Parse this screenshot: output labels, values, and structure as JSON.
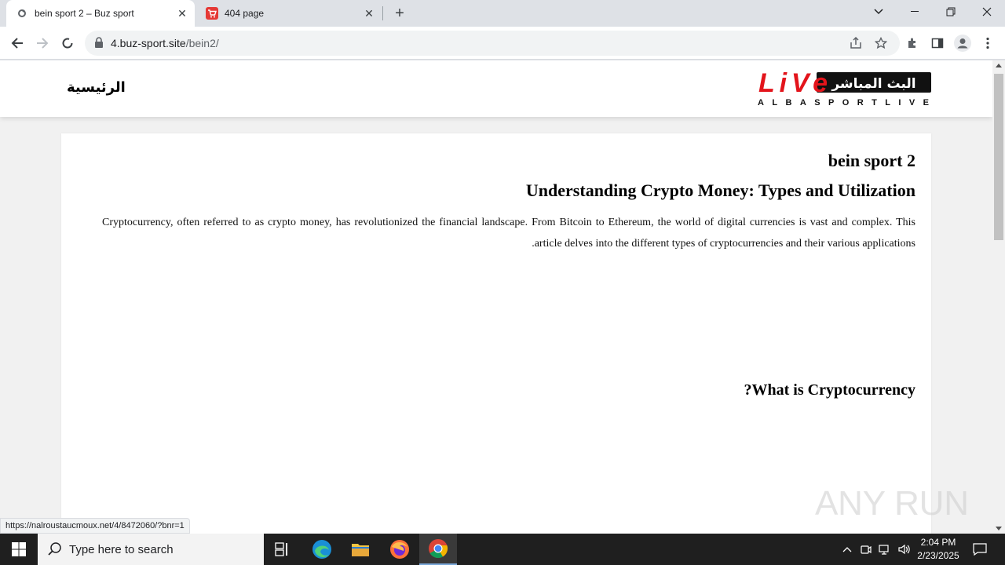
{
  "browser": {
    "tabs": [
      {
        "title": "bein sport 2 – Buz sport",
        "active": true
      },
      {
        "title": "404 page",
        "active": false
      }
    ],
    "url_host": "4.buz-sport.site",
    "url_path": "/bein2/",
    "status_url": "https://nalroustaucmoux.net/4/8472060/?bnr=1"
  },
  "site": {
    "nav_home": "الرئيسية",
    "logo_arabic": "البث المباشر",
    "logo_live": "LiVe",
    "logo_sub": "ALBASPORTLIVE"
  },
  "article": {
    "title": "bein sport 2",
    "heading": "Understanding Crypto Money: Types and Utilization",
    "paragraph": "Cryptocurrency, often referred to as crypto money, has revolutionized the financial landscape. From Bitcoin to Ethereum, the world of digital currencies is vast and complex. This article delves into the different types of cryptocurrencies and their various applications.",
    "subheading": "What is Cryptocurrency?"
  },
  "watermark": "ANY RUN",
  "taskbar": {
    "search_placeholder": "Type here to search",
    "time": "2:04 PM",
    "date": "2/23/2025"
  }
}
